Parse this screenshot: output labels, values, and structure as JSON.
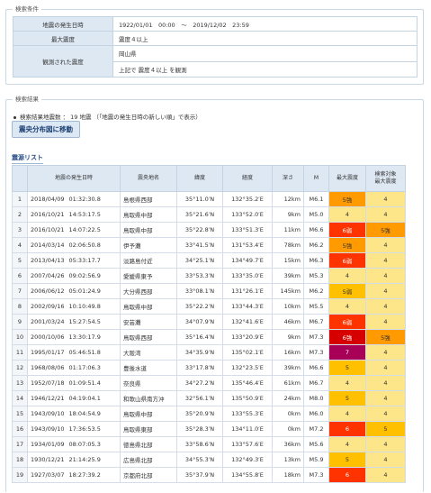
{
  "search_conditions": {
    "legend": "検索条件",
    "rows": [
      {
        "label": "地震の発生日時",
        "value": "1922/01/01　00:00　～　2019/12/02　23:59"
      },
      {
        "label": "最大震度",
        "value": "震度４以上"
      },
      {
        "label": "観測された震度",
        "value": "岡山県",
        "value2": "上記で 震度４以上 を観測"
      }
    ]
  },
  "search_results": {
    "legend": "検索結果",
    "count_text": "検索結果地震数 ： 19 地震 （「地震の発生日時の新しい順」で表示）",
    "map_button": "震央分布図に移動"
  },
  "list_title": "震源リスト",
  "columns": [
    "",
    "地震の発生日時",
    "震央地名",
    "緯度",
    "経度",
    "深さ",
    "M",
    "最大震度",
    "検索対象\n最大震度"
  ],
  "intensity_colors": {
    "4": "#fde58a",
    "5弱": "#ffc000",
    "5強": "#ff9a00",
    "6弱": "#ff3300",
    "6強": "#d60000",
    "7": "#a80057"
  },
  "rows": [
    {
      "no": "1",
      "date": "2018/04/09",
      "time": "01:32:30.8",
      "place": "島根県西部",
      "lat": "35°11.0′N",
      "lon": "132°35.2′E",
      "depth": "12km",
      "m": "M6.1",
      "max": "5強",
      "target": "4"
    },
    {
      "no": "2",
      "date": "2016/10/21",
      "time": "14:53:17.5",
      "place": "鳥取県中部",
      "lat": "35°21.6′N",
      "lon": "133°52.0′E",
      "depth": "9km",
      "m": "M5.0",
      "max": "4",
      "target": "4"
    },
    {
      "no": "3",
      "date": "2016/10/21",
      "time": "14:07:22.5",
      "place": "鳥取県中部",
      "lat": "35°22.8′N",
      "lon": "133°51.3′E",
      "depth": "11km",
      "m": "M6.6",
      "max": "6弱",
      "target": "5強"
    },
    {
      "no": "4",
      "date": "2014/03/14",
      "time": "02:06:50.8",
      "place": "伊予灘",
      "lat": "33°41.5′N",
      "lon": "131°53.4′E",
      "depth": "78km",
      "m": "M6.2",
      "max": "5強",
      "target": "4"
    },
    {
      "no": "5",
      "date": "2013/04/13",
      "time": "05:33:17.7",
      "place": "淡路島付近",
      "lat": "34°25.1′N",
      "lon": "134°49.7′E",
      "depth": "15km",
      "m": "M6.3",
      "max": "6弱",
      "target": "4"
    },
    {
      "no": "6",
      "date": "2007/04/26",
      "time": "09:02:56.9",
      "place": "愛媛県東予",
      "lat": "33°53.3′N",
      "lon": "133°35.0′E",
      "depth": "39km",
      "m": "M5.3",
      "max": "4",
      "target": "4"
    },
    {
      "no": "7",
      "date": "2006/06/12",
      "time": "05:01:24.9",
      "place": "大分県西部",
      "lat": "33°08.1′N",
      "lon": "131°26.1′E",
      "depth": "145km",
      "m": "M6.2",
      "max": "5弱",
      "target": "4"
    },
    {
      "no": "8",
      "date": "2002/09/16",
      "time": "10:10:49.8",
      "place": "鳥取県中部",
      "lat": "35°22.2′N",
      "lon": "133°44.3′E",
      "depth": "10km",
      "m": "M5.5",
      "max": "4",
      "target": "4"
    },
    {
      "no": "9",
      "date": "2001/03/24",
      "time": "15:27:54.5",
      "place": "安芸灘",
      "lat": "34°07.9′N",
      "lon": "132°41.6′E",
      "depth": "46km",
      "m": "M6.7",
      "max": "6弱",
      "target": "4"
    },
    {
      "no": "10",
      "date": "2000/10/06",
      "time": "13:30:17.9",
      "place": "鳥取県西部",
      "lat": "35°16.4′N",
      "lon": "133°20.9′E",
      "depth": "9km",
      "m": "M7.3",
      "max": "6強",
      "target": "5強"
    },
    {
      "no": "11",
      "date": "1995/01/17",
      "time": "05:46:51.8",
      "place": "大阪湾",
      "lat": "34°35.9′N",
      "lon": "135°02.1′E",
      "depth": "16km",
      "m": "M7.3",
      "max": "7",
      "target": "4"
    },
    {
      "no": "12",
      "date": "1968/08/06",
      "time": "01:17:06.3",
      "place": "豊後水道",
      "lat": "33°17.8′N",
      "lon": "132°23.5′E",
      "depth": "39km",
      "m": "M6.6",
      "max": "5",
      "target": "4"
    },
    {
      "no": "13",
      "date": "1952/07/18",
      "time": "01:09:51.4",
      "place": "奈良県",
      "lat": "34°27.2′N",
      "lon": "135°46.4′E",
      "depth": "61km",
      "m": "M6.7",
      "max": "4",
      "target": "4"
    },
    {
      "no": "14",
      "date": "1946/12/21",
      "time": "04:19:04.1",
      "place": "和歌山県南方沖",
      "lat": "32°56.1′N",
      "lon": "135°50.9′E",
      "depth": "24km",
      "m": "M8.0",
      "max": "5",
      "target": "4"
    },
    {
      "no": "15",
      "date": "1943/09/10",
      "time": "18:04:54.9",
      "place": "鳥取県中部",
      "lat": "35°20.9′N",
      "lon": "133°55.3′E",
      "depth": "0km",
      "m": "M6.0",
      "max": "4",
      "target": "4"
    },
    {
      "no": "16",
      "date": "1943/09/10",
      "time": "17:36:53.5",
      "place": "鳥取県東部",
      "lat": "35°28.3′N",
      "lon": "134°11.0′E",
      "depth": "0km",
      "m": "M7.2",
      "max": "6",
      "target": "5"
    },
    {
      "no": "17",
      "date": "1934/01/09",
      "time": "08:07:05.3",
      "place": "徳島県北部",
      "lat": "33°58.6′N",
      "lon": "133°57.6′E",
      "depth": "36km",
      "m": "M5.6",
      "max": "4",
      "target": "4"
    },
    {
      "no": "18",
      "date": "1930/12/21",
      "time": "21:14:25.9",
      "place": "広島県北部",
      "lat": "34°55.3′N",
      "lon": "132°49.3′E",
      "depth": "13km",
      "m": "M5.9",
      "max": "5",
      "target": "4"
    },
    {
      "no": "19",
      "date": "1927/03/07",
      "time": "18:27:39.2",
      "place": "京都府北部",
      "lat": "35°37.9′N",
      "lon": "134°55.8′E",
      "depth": "18km",
      "m": "M7.3",
      "max": "6",
      "target": "4"
    }
  ]
}
